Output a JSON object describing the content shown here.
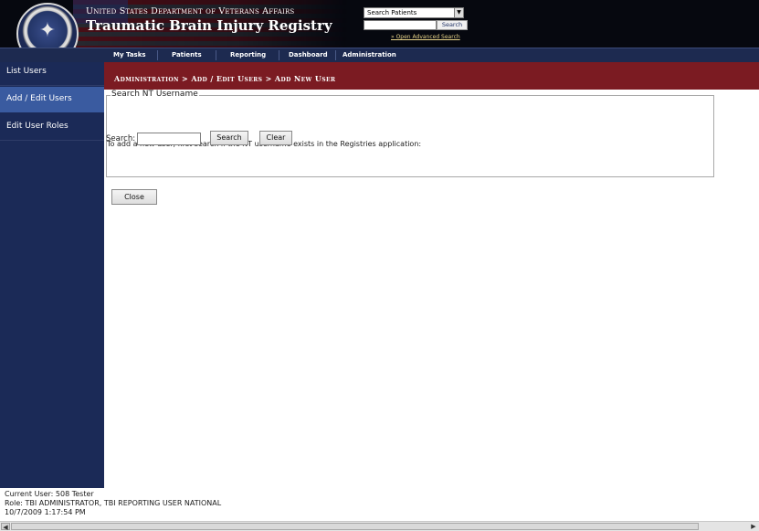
{
  "header": {
    "department": "United States Department of Veterans Affairs",
    "app_title": "Traumatic Brain Injury Registry",
    "search_select_value": "Search Patients",
    "search_button": "Search",
    "advanced_search_link": "» Open Advanced Search"
  },
  "nav": {
    "items": [
      {
        "label": "My Tasks"
      },
      {
        "label": "Patients"
      },
      {
        "label": "Reporting"
      },
      {
        "label": "Dashboard"
      },
      {
        "label": "Administration"
      }
    ]
  },
  "sidebar": {
    "items": [
      {
        "label": "List Users"
      },
      {
        "label": "Add / Edit Users"
      },
      {
        "label": "Edit User Roles"
      }
    ]
  },
  "breadcrumb": "Administration > Add / Edit Users > Add New User",
  "form": {
    "legend": "Search NT Username",
    "instructions": "To add a new user, first search if the NT username exists in the Registries application:",
    "search_label": "Search:",
    "search_value": "",
    "search_button": "Search",
    "clear_button": "Clear",
    "close_button": "Close"
  },
  "footer": {
    "current_user": "Current User:  508 Tester",
    "role": "Role: TBI ADMINISTRATOR, TBI REPORTING USER NATIONAL",
    "timestamp": "10/7/2009 1:17:54 PM"
  },
  "colors": {
    "header_bg": "#06080f",
    "nav_bg": "#1d2a50",
    "sidebar_bg": "#1b2a57",
    "sidebar_active": "#3a5ba0",
    "breadcrumb_bg": "#7b1b22"
  },
  "icons": {
    "seal": "va-seal-icon",
    "dropdown": "chevron-down-icon",
    "scroll_left": "arrow-left-icon",
    "scroll_right": "arrow-right-icon"
  }
}
